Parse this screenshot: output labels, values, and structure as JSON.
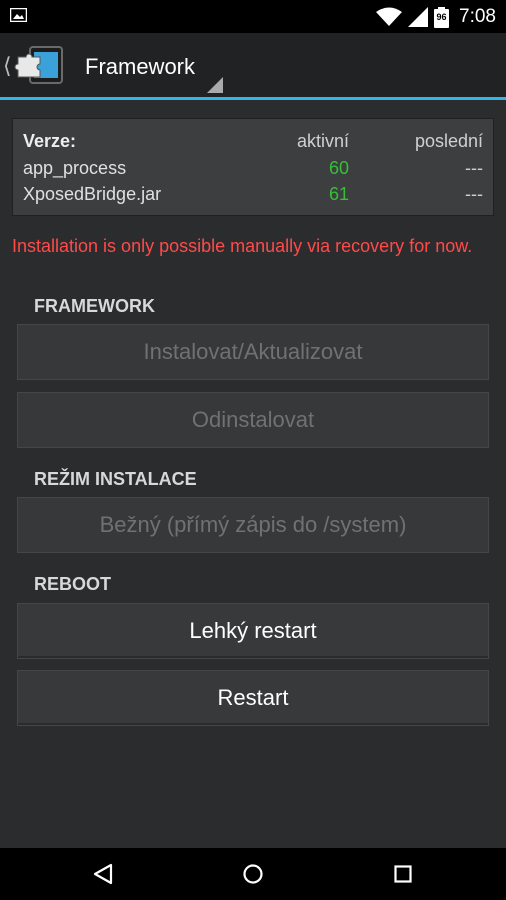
{
  "status_bar": {
    "time": "7:08",
    "battery_level": "96",
    "icons": [
      "image-notification-icon",
      "wifi-icon",
      "signal-icon",
      "battery-icon"
    ]
  },
  "action_bar": {
    "title": "Framework",
    "accent_color": "#33b5e5"
  },
  "versions": {
    "header": {
      "label": "Verze:",
      "active": "aktivní",
      "latest": "poslední"
    },
    "rows": [
      {
        "name": "app_process",
        "active": "60",
        "latest": "---"
      },
      {
        "name": "XposedBridge.jar",
        "active": "61",
        "latest": "---"
      }
    ],
    "active_color": "#35c035"
  },
  "warning": {
    "text": "Installation is only possible manually via recovery for now.",
    "color": "#ff4a4a"
  },
  "sections": {
    "framework": {
      "header": "FRAMEWORK",
      "install_button": "Instalovat/Aktualizovat",
      "uninstall_button": "Odinstalovat"
    },
    "install_mode": {
      "header": "REŽIM INSTALACE",
      "selected": "Bežný (přímý zápis do /system)"
    },
    "reboot": {
      "header": "REBOOT",
      "soft_reboot_button": "Lehký restart",
      "reboot_button": "Restart"
    }
  },
  "nav_bar": {
    "icons": [
      "back-icon",
      "home-icon",
      "recents-icon"
    ]
  }
}
